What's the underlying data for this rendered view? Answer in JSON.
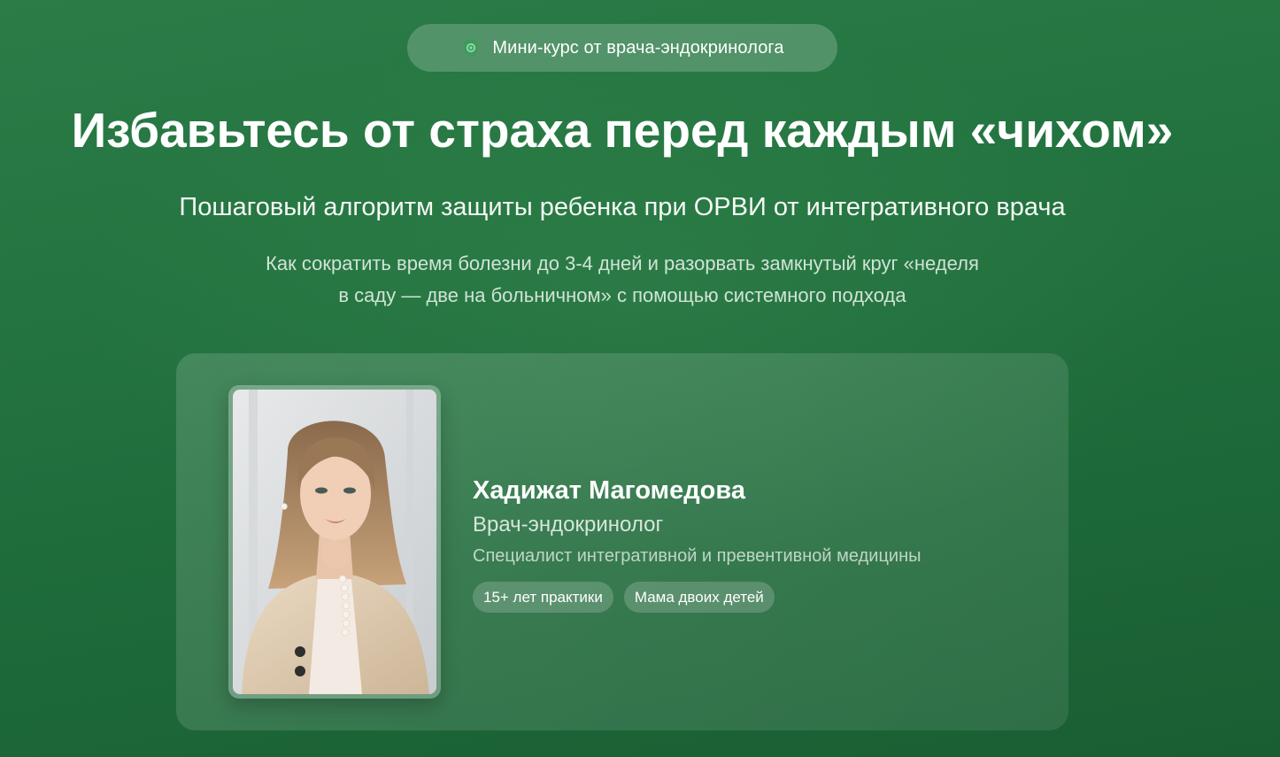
{
  "badge": {
    "icon": "shield-check-icon",
    "text": "Мини-курс от врача-эндокринолога"
  },
  "hero": {
    "title": "Избавьтесь от страха перед каждым «чихом»",
    "subtitle": "Пошаговый алгоритм защиты ребенка при ОРВИ от интегративного врача",
    "lead_lines": [
      "Как сократить время болезни до 3-4 дней и разорвать замкнутый круг «неделя",
      "в саду — две на больничном» с помощью системного подхода"
    ]
  },
  "expert": {
    "name": "Хадижат Магомедова",
    "role": "Врач-эндокринолог",
    "specialization": "Специалист интегративной и превентивной медицины",
    "tags": [
      "15+ лет практики",
      "Мама двоих детей"
    ]
  },
  "colors": {
    "background": "#237340",
    "text": "#ffffff",
    "badge_icon": "#4caf6e"
  }
}
